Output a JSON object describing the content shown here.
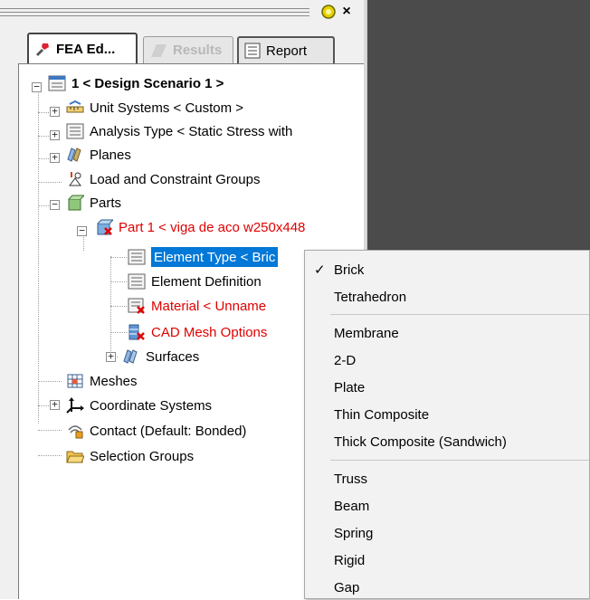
{
  "tabs": [
    {
      "label": "FEA Ed..."
    },
    {
      "label": "Results"
    },
    {
      "label": "Report"
    }
  ],
  "tree": {
    "root": "1 < Design Scenario 1 >",
    "items": [
      {
        "label": "Unit Systems < Custom >"
      },
      {
        "label": "Analysis Type < Static Stress with"
      },
      {
        "label": "Planes"
      },
      {
        "label": "Load and Constraint Groups"
      },
      {
        "label": "Parts"
      },
      {
        "label": "Part 1 < viga de aco w250x448"
      },
      {
        "label": "Element Type < Bric"
      },
      {
        "label": "Element Definition"
      },
      {
        "label": "Material < Unname"
      },
      {
        "label": "CAD Mesh Options"
      },
      {
        "label": "Surfaces"
      },
      {
        "label": "Meshes"
      },
      {
        "label": "Coordinate Systems"
      },
      {
        "label": "Contact (Default: Bonded)"
      },
      {
        "label": "Selection Groups"
      }
    ]
  },
  "menu": {
    "items": [
      {
        "label": "Brick",
        "checked": true
      },
      {
        "label": "Tetrahedron"
      },
      {
        "label": "Membrane"
      },
      {
        "label": "2-D"
      },
      {
        "label": "Plate"
      },
      {
        "label": "Thin Composite"
      },
      {
        "label": "Thick Composite (Sandwich)"
      },
      {
        "label": "Truss"
      },
      {
        "label": "Beam"
      },
      {
        "label": "Spring"
      },
      {
        "label": "Rigid"
      },
      {
        "label": "Gap"
      }
    ],
    "check_mark": "✓"
  },
  "window": {
    "close_glyph": "×"
  },
  "colors": {
    "selection": "#0078d7",
    "error_text": "#e00000",
    "viewport": "#4b4b4b"
  }
}
